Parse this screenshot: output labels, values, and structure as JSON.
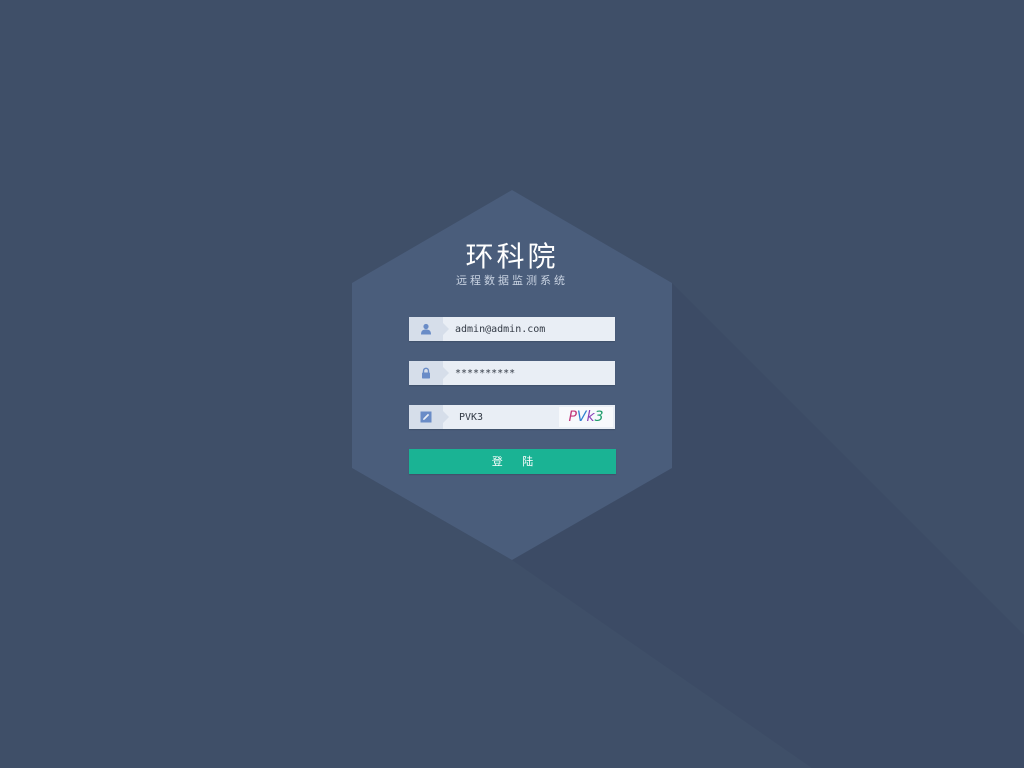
{
  "brand": {
    "title": "环科院",
    "subtitle": "远程数据监测系统"
  },
  "form": {
    "username": {
      "value": "admin@admin.com",
      "icon": "user-icon"
    },
    "password": {
      "value": "**********",
      "icon": "lock-icon"
    },
    "captcha": {
      "value": "PVK3",
      "icon": "edit-icon",
      "image_text": [
        "P",
        "V",
        "k",
        "3"
      ]
    },
    "login_label": "登 陆"
  },
  "colors": {
    "background": "#3f4f68",
    "hexagon": "#4a5d7b",
    "field": "#e9eef5",
    "icon_cell": "#d6deea",
    "icon": "#6a8cc7",
    "accent": "#1ab394"
  }
}
